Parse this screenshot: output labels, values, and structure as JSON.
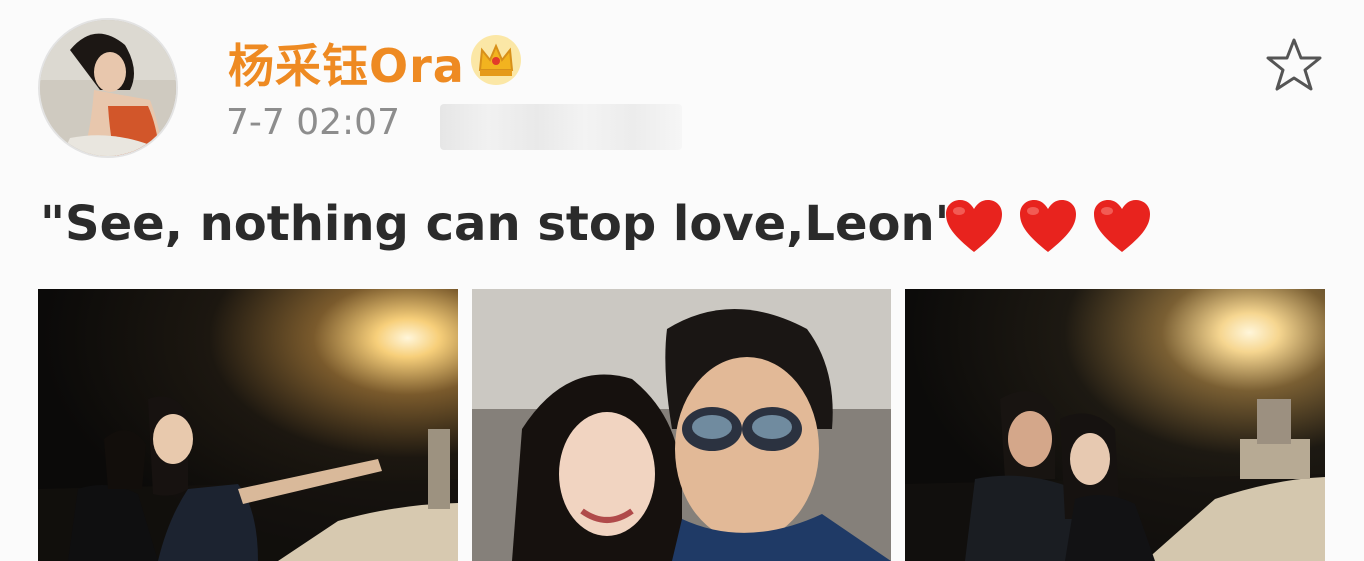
{
  "post": {
    "author": {
      "name": "杨采钰Ora",
      "badge_icon": "crown-icon",
      "avatar_icon": "avatar"
    },
    "timestamp": "7-7 02:07",
    "text": "\"See, nothing can stop love,Leon\"",
    "emoji": [
      "heart-icon",
      "heart-icon",
      "heart-icon"
    ],
    "favorite_icon": "star-icon",
    "photos": [
      "photo-1",
      "photo-2",
      "photo-3"
    ]
  },
  "colors": {
    "username": "#ee8a22",
    "timestamp": "#8d8d8d",
    "text": "#2b2b2b",
    "heart": "#e8231e",
    "background": "#fbfbfb"
  }
}
